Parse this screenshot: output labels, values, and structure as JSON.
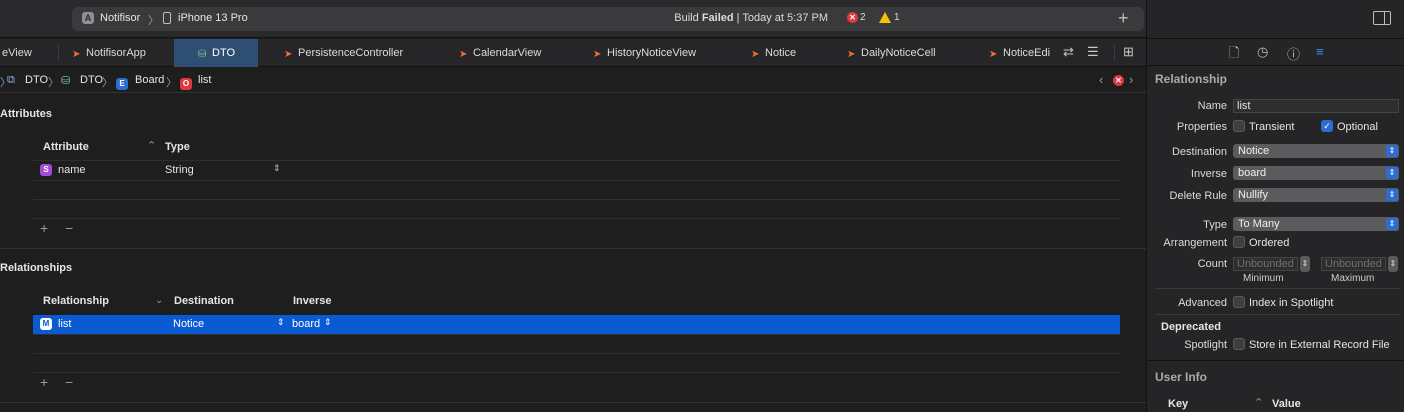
{
  "toolbar": {
    "scheme": "Notifisor",
    "device": "iPhone 13 Pro",
    "build_prefix": "Build",
    "build_state": "Failed",
    "build_time": "| Today at 5:37 PM",
    "error_count": "2",
    "warning_count": "1",
    "add": "+"
  },
  "tabs": [
    {
      "label": "eView"
    },
    {
      "label": "NotifisorApp"
    },
    {
      "label": "DTO"
    },
    {
      "label": "PersistenceController"
    },
    {
      "label": "CalendarView"
    },
    {
      "label": "HistoryNoticeView"
    },
    {
      "label": "Notice"
    },
    {
      "label": "DailyNoticeCell"
    },
    {
      "label": "NoticeEdi"
    }
  ],
  "breadcrumb": {
    "item1": "DTO",
    "item2": "DTO",
    "item3": "Board",
    "item4": "list",
    "entity_badge": "E",
    "list_badge": "O"
  },
  "attributes": {
    "title": "Attributes",
    "col_attribute": "Attribute",
    "col_type": "Type",
    "rows": [
      {
        "badge": "S",
        "name": "name",
        "type": "String"
      }
    ],
    "add": "+",
    "remove": "−"
  },
  "relationships": {
    "title": "Relationships",
    "col_relationship": "Relationship",
    "col_destination": "Destination",
    "col_inverse": "Inverse",
    "rows": [
      {
        "badge": "M",
        "name": "list",
        "destination": "Notice",
        "inverse": "board"
      }
    ],
    "add": "+",
    "remove": "−"
  },
  "inspector": {
    "section_title": "Relationship",
    "name_label": "Name",
    "name_value": "list",
    "properties_label": "Properties",
    "transient_label": "Transient",
    "optional_label": "Optional",
    "destination_label": "Destination",
    "destination_value": "Notice",
    "inverse_label": "Inverse",
    "inverse_value": "board",
    "delete_rule_label": "Delete Rule",
    "delete_rule_value": "Nullify",
    "type_label": "Type",
    "type_value": "To Many",
    "arrangement_label": "Arrangement",
    "ordered_label": "Ordered",
    "count_label": "Count",
    "min_placeholder": "Unbounded",
    "max_placeholder": "Unbounded",
    "min_label": "Minimum",
    "max_label": "Maximum",
    "advanced_label": "Advanced",
    "spotlight_index_label": "Index in Spotlight",
    "deprecated_title": "Deprecated",
    "spotlight_label": "Spotlight",
    "external_record_label": "Store in External Record File",
    "user_info_title": "User Info",
    "col_key": "Key",
    "col_value": "Value"
  },
  "colors": {
    "selection": "#0a5ad4",
    "tab_active": "#2e4e72",
    "error": "#e0383e",
    "warning": "#f5c400",
    "accent": "#2f6ccf"
  }
}
